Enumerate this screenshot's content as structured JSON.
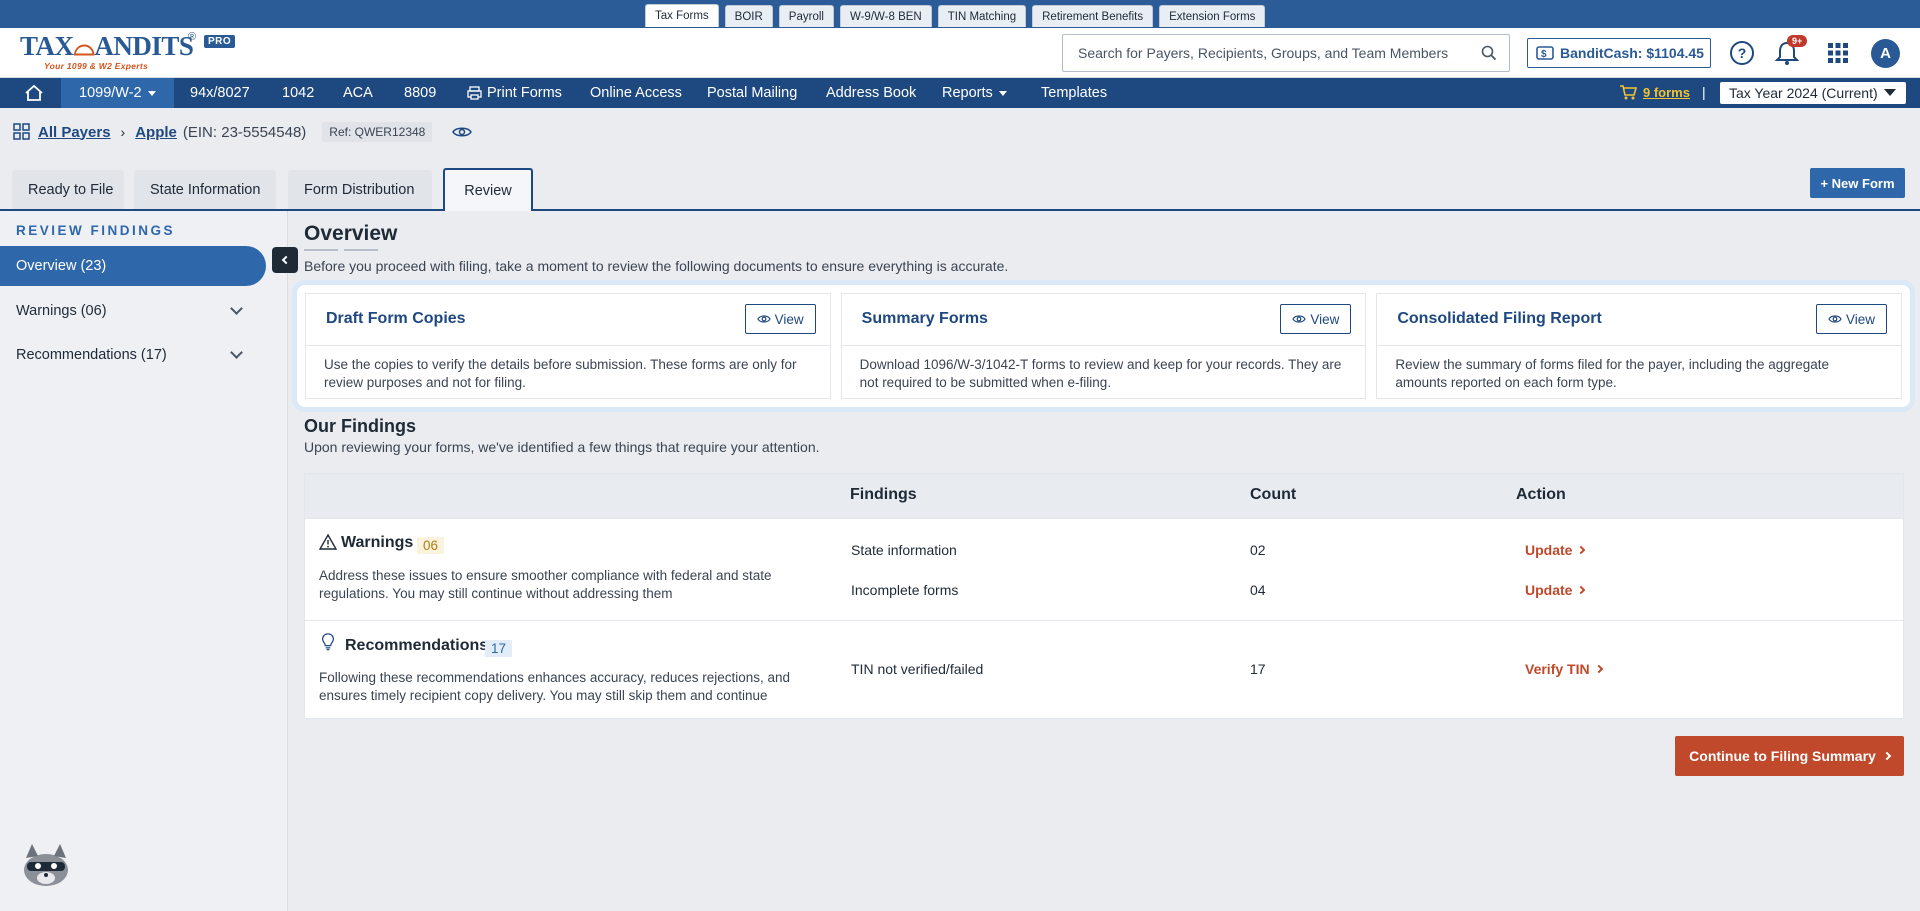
{
  "product_tabs": [
    "Tax Forms",
    "BOIR",
    "Payroll",
    "W-9/W-8 BEN",
    "TIN Matching",
    "Retirement Benefits",
    "Extension Forms"
  ],
  "header": {
    "logo_text_a": "TAX",
    "logo_text_b": "ANDITS",
    "logo_tagline": "Your 1099 & W2 Experts",
    "logo_badge": "PRO",
    "search_placeholder": "Search for Payers, Recipients, Groups, and Team Members",
    "bandit_cash": "BanditCash: $1104.45",
    "notifications_badge": "9+",
    "avatar_initial": "A"
  },
  "nav": {
    "items": [
      "1099/W-2",
      "94x/8027",
      "1042",
      "ACA",
      "8809",
      "Print Forms",
      "Online Access",
      "Postal Mailing",
      "Address Book",
      "Reports",
      "Templates"
    ],
    "cart_label": "9 forms",
    "separator": "|",
    "tax_year": "Tax Year 2024 (Current)"
  },
  "breadcrumb": {
    "all_payers": "All Payers",
    "payer": "Apple",
    "ein": "(EIN: 23-5554548)",
    "ref": "Ref: QWER12348"
  },
  "tabs": [
    "Ready to File",
    "State Information",
    "Form Distribution",
    "Review"
  ],
  "new_form_button": "+ New Form",
  "sidebar": {
    "heading": "REVIEW FINDINGS",
    "overview": "Overview (23)",
    "warnings": "Warnings (06)",
    "recommendations": "Recommendations (17)"
  },
  "overview": {
    "title": "Overview",
    "subtitle": "Before you proceed with filing, take a moment to review the following documents to ensure everything is accurate.",
    "cards": [
      {
        "title": "Draft Form Copies",
        "description": "Use the copies to verify the details before submission. These forms are only for review purposes and not for filing.",
        "button": "View"
      },
      {
        "title": "Summary Forms",
        "description": "Download 1096/W-3/1042-T forms to review and keep for your records. They are not required to be submitted when e-filing.",
        "button": "View"
      },
      {
        "title": "Consolidated Filing Report",
        "description": "Review the summary of forms filed for the payer, including the aggregate amounts reported on each form type.",
        "button": "View"
      }
    ]
  },
  "findings": {
    "title": "Our Findings",
    "subtitle": "Upon reviewing your forms, we've identified a few things that require your attention.",
    "columns": [
      "Findings",
      "Count",
      "Action"
    ],
    "warnings": {
      "title": "Warnings",
      "badge": "06",
      "description": "Address these issues to ensure smoother compliance with federal and state regulations. You may still continue without addressing them",
      "rows": [
        {
          "finding": "State information",
          "count": "02",
          "action": "Update"
        },
        {
          "finding": "Incomplete forms",
          "count": "04",
          "action": "Update"
        }
      ]
    },
    "recommendations": {
      "title": "Recommendations",
      "badge": "17",
      "description": "Following these recommendations enhances accuracy, reduces rejections, and ensures timely recipient copy delivery. You may still skip them and continue",
      "rows": [
        {
          "finding": "TIN not verified/failed",
          "count": "17",
          "action": "Verify TIN"
        }
      ]
    }
  },
  "continue_button": "Continue to Filing Summary",
  "colors": {
    "primary": "#1e4880",
    "accent": "#2f67ab",
    "action": "#c0492b",
    "warning": "#b07d12"
  }
}
